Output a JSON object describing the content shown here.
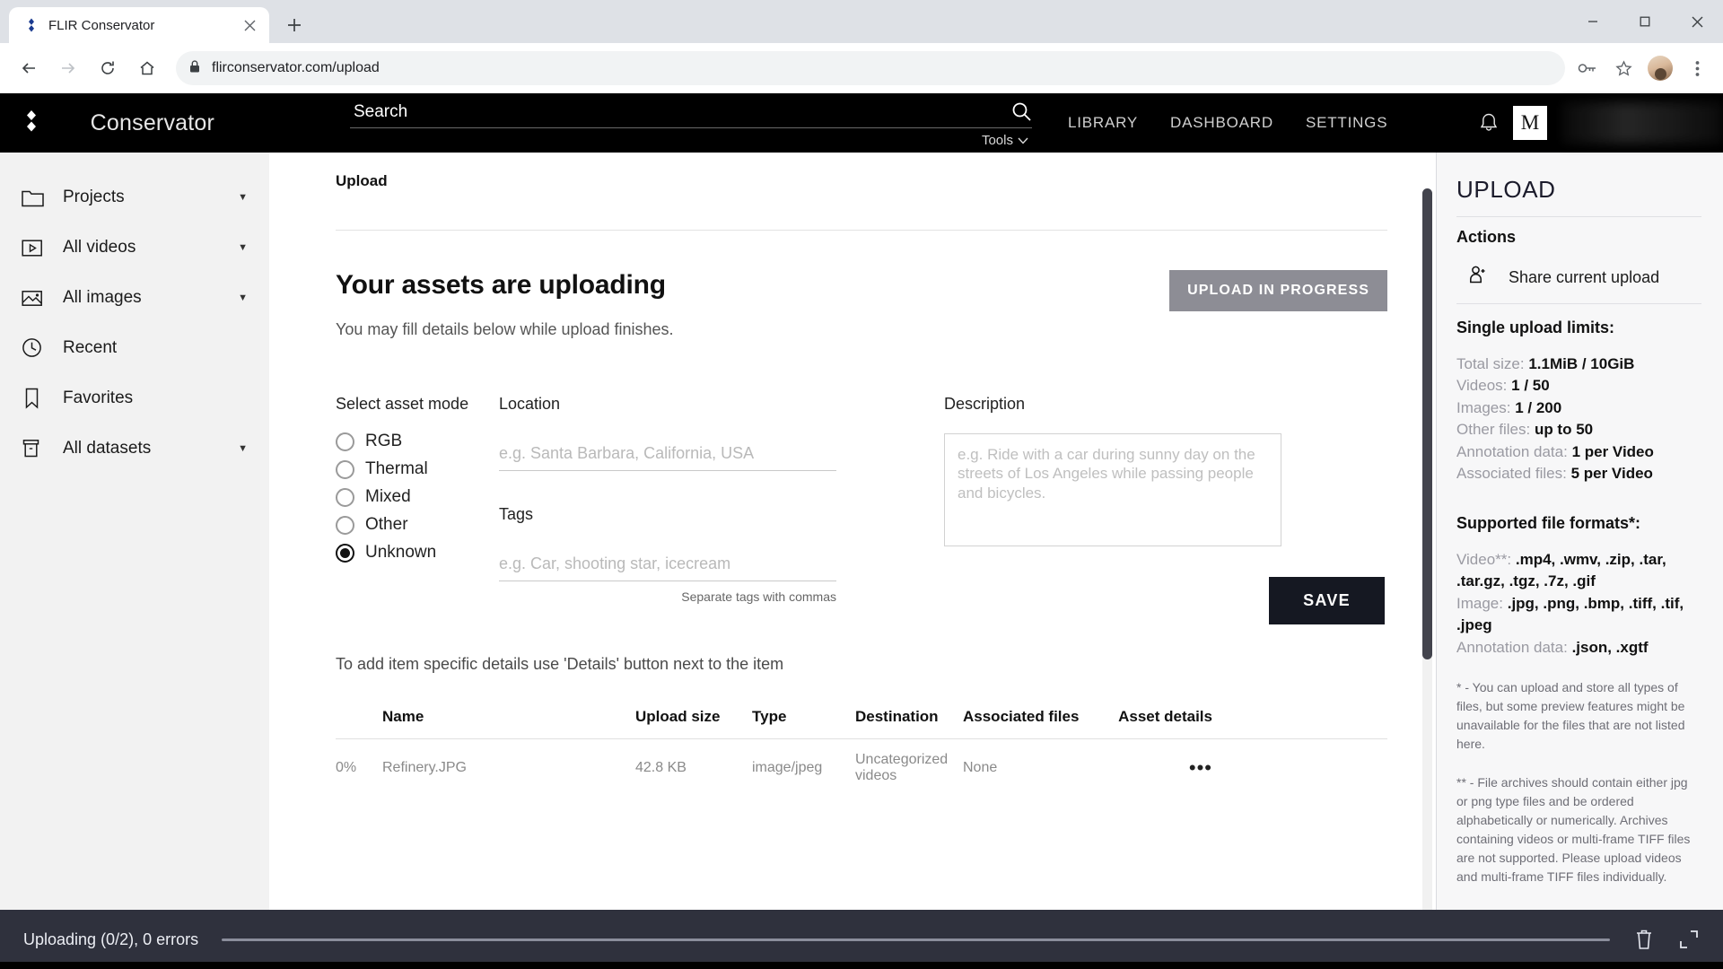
{
  "browser": {
    "tab": {
      "title": "FLIR Conservator",
      "favicon": "flir-diamond-icon",
      "close": "✕"
    },
    "newtab_label": "+",
    "nav": {
      "back": "back-arrow-icon",
      "forward": "forward-arrow-icon",
      "reload": "reload-icon",
      "home": "home-icon"
    },
    "omnibox": {
      "lock": "lock-icon",
      "url": "flirconservator.com/upload"
    },
    "toolbar_icons": [
      "key-icon",
      "star-icon",
      "profile-avatar",
      "menu-kebab-icon"
    ],
    "window": {
      "minimize": "minimize-icon",
      "maximize": "maximize-icon",
      "close": "close-icon"
    }
  },
  "appbar": {
    "brand_flir": "FLIR",
    "brand_sub": "Conservator",
    "search_placeholder": "Search",
    "search_value": "Search",
    "tools_label": "Tools",
    "nav_items": [
      "LIBRARY",
      "DASHBOARD",
      "SETTINGS"
    ],
    "bell": "notification-bell-icon",
    "avatar_initial": "M"
  },
  "sidebar": {
    "items": [
      {
        "label": "Projects",
        "icon": "folder-icon",
        "caret": true
      },
      {
        "label": "All videos",
        "icon": "video-icon",
        "caret": true
      },
      {
        "label": "All images",
        "icon": "image-icon",
        "caret": true
      },
      {
        "label": "Recent",
        "icon": "clock-icon",
        "caret": false
      },
      {
        "label": "Favorites",
        "icon": "bookmark-icon",
        "caret": false
      },
      {
        "label": "All datasets",
        "icon": "dataset-icon",
        "caret": true
      }
    ]
  },
  "main": {
    "breadcrumb": "Upload",
    "title": "Your assets are uploading",
    "subtitle": "You may fill details below while upload finishes.",
    "progress_button": "UPLOAD IN PROGRESS",
    "asset_mode": {
      "label": "Select asset mode",
      "options": [
        "RGB",
        "Thermal",
        "Mixed",
        "Other",
        "Unknown"
      ],
      "selected": "Unknown"
    },
    "location": {
      "label": "Location",
      "placeholder": "e.g. Santa Barbara, California, USA",
      "value": ""
    },
    "tags": {
      "label": "Tags",
      "placeholder": "e.g. Car, shooting star, icecream",
      "value": "",
      "hint": "Separate tags with commas"
    },
    "description": {
      "label": "Description",
      "placeholder": "e.g. Ride with a car during sunny day on the streets of Los Angeles while passing people and bicycles.",
      "value": ""
    },
    "save_button": "SAVE",
    "details_hint": "To add item specific details use 'Details' button next to the item",
    "table": {
      "columns": [
        "",
        "Name",
        "Upload size",
        "Type",
        "Destination",
        "Associated files",
        "Asset details"
      ],
      "rows": [
        {
          "progress": "0%",
          "name": "Refinery.JPG",
          "upload_size": "42.8 KB",
          "type": "image/jpeg",
          "destination": "Uncategorized videos",
          "associated_files": "None",
          "asset_details": "•••"
        }
      ]
    }
  },
  "rightpanel": {
    "title": "UPLOAD",
    "actions_label": "Actions",
    "share_label": "Share current upload",
    "share_icon": "person-add-icon",
    "limits_title": "Single upload limits:",
    "limits": [
      {
        "label": "Total size:",
        "value": "1.1MiB / 10GiB"
      },
      {
        "label": "Videos:",
        "value": "1 / 50"
      },
      {
        "label": "Images:",
        "value": "1 / 200"
      },
      {
        "label": "Other files:",
        "value": "up to 50"
      },
      {
        "label": "Annotation data:",
        "value": "1 per Video"
      },
      {
        "label": "Associated files:",
        "value": "5 per Video"
      }
    ],
    "formats_title": "Supported file formats*:",
    "formats": [
      {
        "label": "Video**:",
        "value": ".mp4, .wmv, .zip, .tar, .tar.gz, .tgz, .7z, .gif"
      },
      {
        "label": "Image:",
        "value": ".jpg, .png, .bmp, .tiff, .tif, .jpeg"
      },
      {
        "label": "Annotation data:",
        "value": ".json, .xgtf"
      }
    ],
    "footnote_1": "* - You can upload and store all types of files, but some preview features might be unavailable for the files that are not listed here.",
    "footnote_2": "** - File archives should contain either jpg or png type files and be ordered alphabetically or numerically. Archives containing videos or multi-frame TIFF files are not supported. Please upload videos and multi-frame TIFF files individually."
  },
  "statusbar": {
    "text": "Uploading (0/2), 0 errors",
    "delete_icon": "trash-icon",
    "expand_icon": "expand-icon"
  },
  "colors": {
    "appbar_bg": "#000000",
    "sidebar_bg": "#f2f2f2",
    "rightpanel_bg": "#f7f7f8",
    "statusbar_bg": "#2f313d",
    "save_button_bg": "#151822",
    "progress_button_bg": "#8d8d95"
  }
}
